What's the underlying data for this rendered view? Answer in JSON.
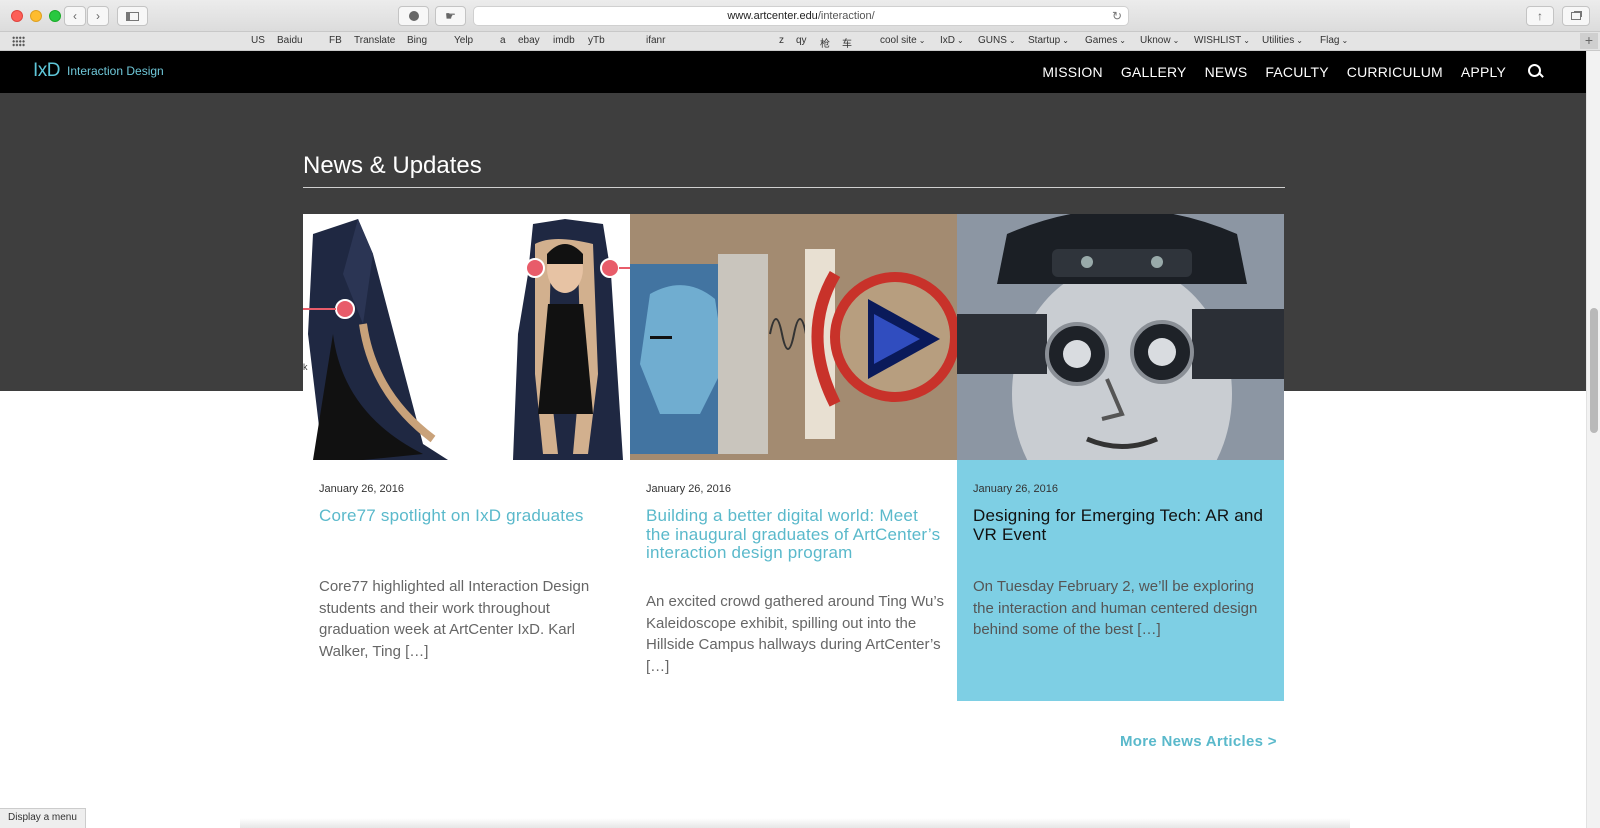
{
  "browser": {
    "url_domain": "www.artcenter.edu",
    "url_path": "/interaction/",
    "bookmarks": [
      {
        "label": "US"
      },
      {
        "label": "Baidu"
      },
      {
        "label": "FB"
      },
      {
        "label": "Translate"
      },
      {
        "label": "Bing"
      },
      {
        "label": "Yelp"
      },
      {
        "label": "a"
      },
      {
        "label": "ebay"
      },
      {
        "label": "imdb"
      },
      {
        "label": "yTb"
      },
      {
        "label": "ifanr"
      },
      {
        "label": "z"
      },
      {
        "label": "qy"
      },
      {
        "label": "枪"
      },
      {
        "label": "车"
      },
      {
        "label": "cool site",
        "menu": true
      },
      {
        "label": "IxD",
        "menu": true
      },
      {
        "label": "GUNS",
        "menu": true
      },
      {
        "label": "Startup",
        "menu": true
      },
      {
        "label": "Games",
        "menu": true
      },
      {
        "label": "Uknow",
        "menu": true
      },
      {
        "label": "WISHLIST",
        "menu": true
      },
      {
        "label": "Utilities",
        "menu": true
      },
      {
        "label": "Flag",
        "menu": true
      }
    ]
  },
  "header": {
    "logo": "IxD",
    "logo_subtitle": "Interaction Design",
    "nav": [
      "MISSION",
      "GALLERY",
      "NEWS",
      "FACULTY",
      "CURRICULUM",
      "APPLY"
    ]
  },
  "section": {
    "title": "News & Updates"
  },
  "cards": [
    {
      "date": "January 26, 2016",
      "title": "Core77 spotlight on IxD graduates",
      "excerpt": "Core77 highlighted all Interaction Design students and their work throughout graduation week  at  ArtCenter IxD. Karl Walker, Ting […]"
    },
    {
      "date": "January 26, 2016",
      "title": "Building a better digital world: Meet the inaugural graduates of ArtCenter’s interaction design program",
      "excerpt": "An excited crowd gathered around Ting Wu’s Kaleidoscope exhibit, spilling out into the Hillside Campus hallways during ArtCenter’s […]"
    },
    {
      "date": "January 26, 2016",
      "title": "Designing for Emerging Tech: AR and VR Event",
      "excerpt": "On Tuesday February 2, we’ll be exploring the interaction  and human centered design behind some of the best […]"
    }
  ],
  "more_news": "More News Articles >",
  "status_text": "Display a menu",
  "colors": {
    "accent": "#5ab9cb",
    "highlight_card": "#7ecfe4",
    "dark_band": "#3e3e3e"
  }
}
